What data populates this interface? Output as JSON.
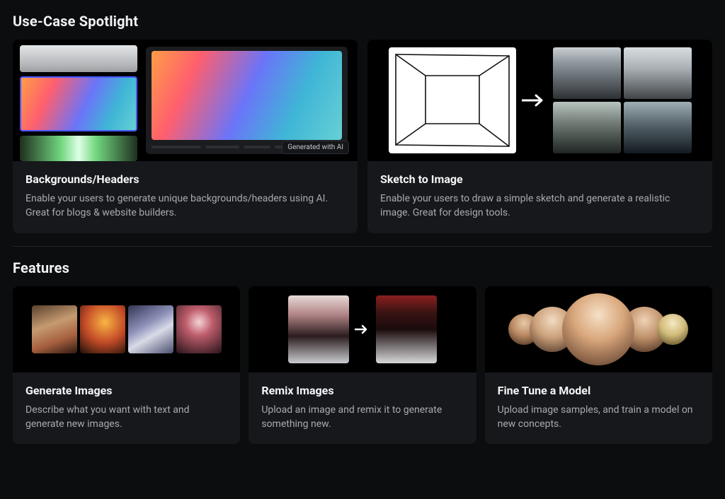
{
  "sections": {
    "spotlight_title": "Use-Case Spotlight",
    "features_title": "Features"
  },
  "spotlight": [
    {
      "id": "backgrounds-headers",
      "title": "Backgrounds/Headers",
      "description": "Enable your users to generate unique backgrounds/headers using AI. Great for blogs & website builders.",
      "badge": "Generated with AI"
    },
    {
      "id": "sketch-to-image",
      "title": "Sketch to Image",
      "description": "Enable your users to draw a simple sketch and generate a realistic image. Great for design tools."
    }
  ],
  "features": [
    {
      "id": "generate-images",
      "title": "Generate Images",
      "description": "Describe what you want with text and generate new images."
    },
    {
      "id": "remix-images",
      "title": "Remix Images",
      "description": "Upload an image and remix it to generate something new."
    },
    {
      "id": "fine-tune-model",
      "title": "Fine Tune a Model",
      "description": "Upload image samples, and train a model on new concepts."
    }
  ]
}
